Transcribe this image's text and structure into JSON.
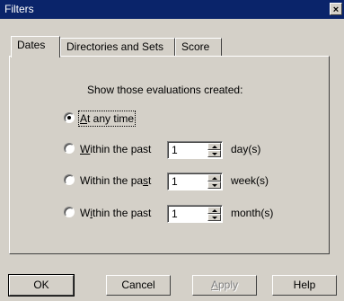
{
  "window": {
    "title": "Filters",
    "close_glyph": "×"
  },
  "tabs": [
    {
      "label": "Dates",
      "active": true
    },
    {
      "label": "Directories and Sets",
      "active": false
    },
    {
      "label": "Score",
      "active": false
    }
  ],
  "dates": {
    "heading": "Show those evaluations created:",
    "options": [
      {
        "label_mnemonic": "A",
        "label_rest": "t any time",
        "selected": true
      },
      {
        "label_mnemonic": "W",
        "label_rest": "ithin the past",
        "value": "1",
        "unit": "day(s)",
        "selected": false
      },
      {
        "label_prefix": "Within the pa",
        "label_mnemonic": "s",
        "label_rest": "t",
        "value": "1",
        "unit": "week(s)",
        "selected": false
      },
      {
        "label_prefix": "W",
        "label_mnemonic": "i",
        "label_rest": "thin the past",
        "value": "1",
        "unit": "month(s)",
        "selected": false
      }
    ]
  },
  "buttons": {
    "ok": "OK",
    "cancel": "Cancel",
    "apply_mnemonic": "A",
    "apply_rest": "pply",
    "help": "Help"
  },
  "colors": {
    "titlebar": "#0a246a",
    "face": "#d4d0c8"
  }
}
